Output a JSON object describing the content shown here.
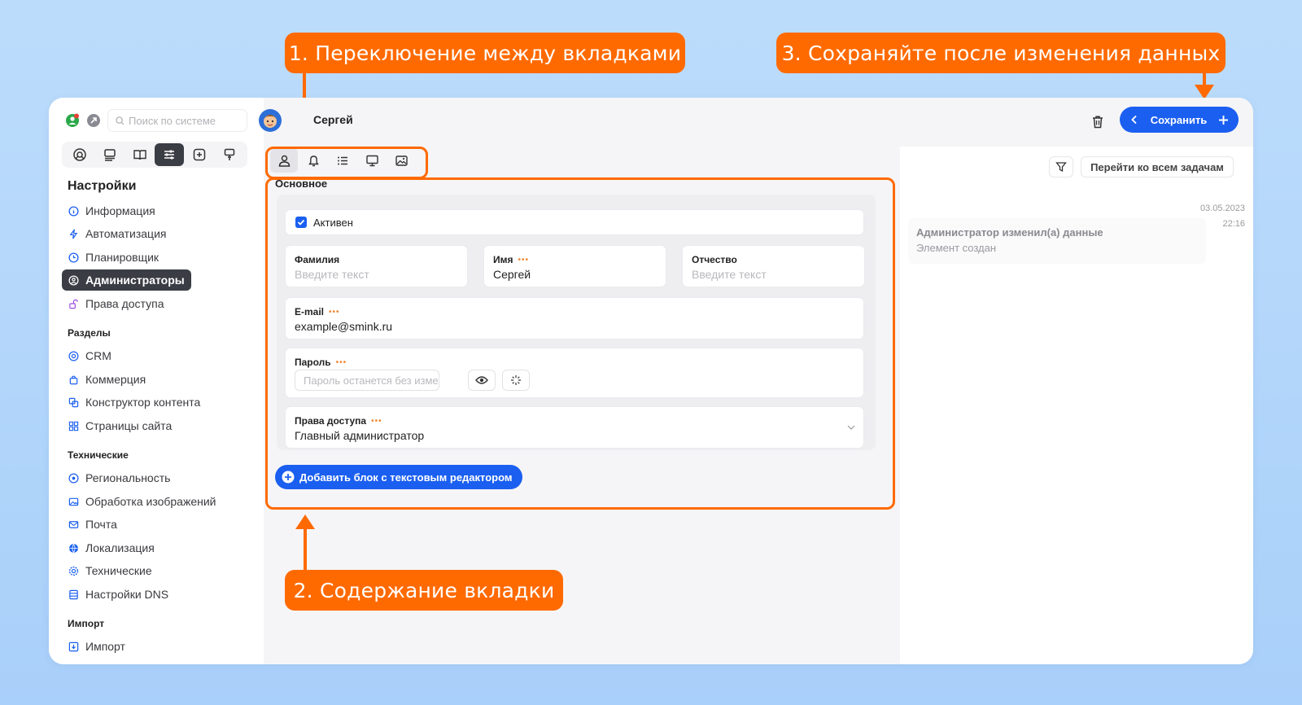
{
  "callouts": {
    "tabs": "1. Переключение между вкладками",
    "content": "2. Содержание вкладки",
    "save": "3. Сохраняйте после изменения данных"
  },
  "colors": {
    "accent": "#ff6a00",
    "primary": "#1a5ff0",
    "dark": "#3a3d44"
  },
  "sidebar": {
    "search_placeholder": "Поиск по системе",
    "settings_title": "Настройки",
    "settings_items": [
      {
        "label": "Информация",
        "icon": "info-icon"
      },
      {
        "label": "Автоматизация",
        "icon": "lightning-icon"
      },
      {
        "label": "Планировщик",
        "icon": "clock-icon"
      },
      {
        "label": "Администраторы",
        "icon": "user-circle-icon"
      },
      {
        "label": "Права доступа",
        "icon": "unlock-icon"
      }
    ],
    "sections_title": "Разделы",
    "sections_items": [
      {
        "label": "CRM",
        "icon": "crm-icon"
      },
      {
        "label": "Коммерция",
        "icon": "bag-icon"
      },
      {
        "label": "Конструктор контента",
        "icon": "content-icon"
      },
      {
        "label": "Страницы сайта",
        "icon": "grid-icon"
      }
    ],
    "tech_title": "Технические",
    "tech_items": [
      {
        "label": "Региональность",
        "icon": "location-icon"
      },
      {
        "label": "Обработка изображений",
        "icon": "image-icon"
      },
      {
        "label": "Почта",
        "icon": "mail-icon"
      },
      {
        "label": "Локализация",
        "icon": "globe-icon"
      },
      {
        "label": "Технические",
        "icon": "gear-icon"
      },
      {
        "label": "Настройки DNS",
        "icon": "server-icon"
      }
    ],
    "import_title": "Импорт",
    "import_items": [
      {
        "label": "Импорт",
        "icon": "download-icon"
      }
    ]
  },
  "header": {
    "user_name": "Сергей",
    "save_label": "Сохранить"
  },
  "main": {
    "section_title": "Основное",
    "active_label": "Активен",
    "fields": {
      "lastname": {
        "label": "Фамилия",
        "placeholder": "Введите текст"
      },
      "firstname": {
        "label": "Имя",
        "value": "Сергей",
        "required": "•••"
      },
      "middlename": {
        "label": "Отчество",
        "placeholder": "Введите текст"
      },
      "email": {
        "label": "E-mail",
        "value": "example@smink.ru",
        "required": "•••"
      },
      "password": {
        "label": "Пароль",
        "placeholder": "Пароль останется без изменений",
        "required": "•••"
      },
      "access": {
        "label": "Права доступа",
        "value": "Главный администратор",
        "required": "•••"
      }
    },
    "add_block_label": "Добавить блок с текстовым редактором"
  },
  "right_panel": {
    "all_tasks_label": "Перейти ко всем задачам",
    "history": [
      {
        "date": "03.05.2023",
        "time": "22:16",
        "title": "Администратор изменил(а) данные",
        "subtitle": "Элемент создан"
      }
    ]
  }
}
